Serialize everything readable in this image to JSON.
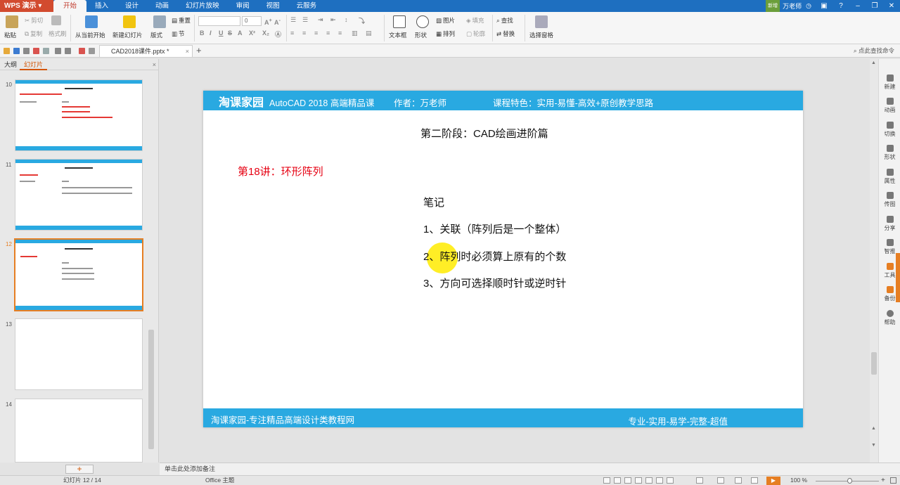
{
  "app": {
    "name": "WPS 演示",
    "tabs": [
      "开始",
      "插入",
      "设计",
      "动画",
      "幻灯片放映",
      "审阅",
      "视图",
      "云服务"
    ],
    "active_tab": "开始",
    "user": "万老师",
    "avatar_label": "新增"
  },
  "ribbon": {
    "paste": "粘贴",
    "cut": "剪切",
    "copy": "复制",
    "format_painter": "格式刷",
    "from_start": "从当前开始",
    "new_slide": "新建幻灯片",
    "layout": "版式",
    "section": "节",
    "reset": "重置",
    "font_name": "",
    "font_size": "0",
    "textbox": "文本框",
    "shape": "形状",
    "arrange": "排列",
    "picture": "图片",
    "fill": "填充",
    "outline": "轮廓",
    "find": "查找",
    "replace": "替换",
    "selection_pane": "选择窗格"
  },
  "quickbar": {
    "doc_tab": "CAD2018课件.pptx *",
    "search_help": "点此查找命令"
  },
  "left_panel": {
    "tab_outline": "大纲",
    "tab_slides": "幻灯片",
    "slides": [
      {
        "num": "10",
        "selected": false
      },
      {
        "num": "11",
        "selected": false
      },
      {
        "num": "12",
        "selected": true
      },
      {
        "num": "13",
        "selected": false
      },
      {
        "num": "14",
        "selected": false
      }
    ],
    "add_button": "+"
  },
  "slide": {
    "brand": "淘课家园",
    "course": "AutoCAD 2018  高端精品课",
    "author": "作者：万老师",
    "feature": "课程特色：实用-易懂-高效+原创教学思路",
    "stage": "第二阶段：CAD绘画进阶篇",
    "lecture": "第18讲：环形阵列",
    "notes_title": "笔记",
    "items": [
      "1、关联（阵列后是一个整体）",
      "2、阵列时必须算上原有的个数",
      "3、方向可选择顺时针或逆时针"
    ],
    "footer_site": "淘课家园-专注精品高端设计类教程网",
    "footer_motto": "专业-实用-易学-完整-超值"
  },
  "right_tools": [
    "新建",
    "动画",
    "切换",
    "形状",
    "属性",
    "传图",
    "分享",
    "智推",
    "工具",
    "备份",
    "帮助"
  ],
  "notes_placeholder": "单击此处添加备注",
  "status": {
    "slide": "幻灯片 12 / 14",
    "theme": "Office 主题",
    "zoom": "100 %"
  }
}
